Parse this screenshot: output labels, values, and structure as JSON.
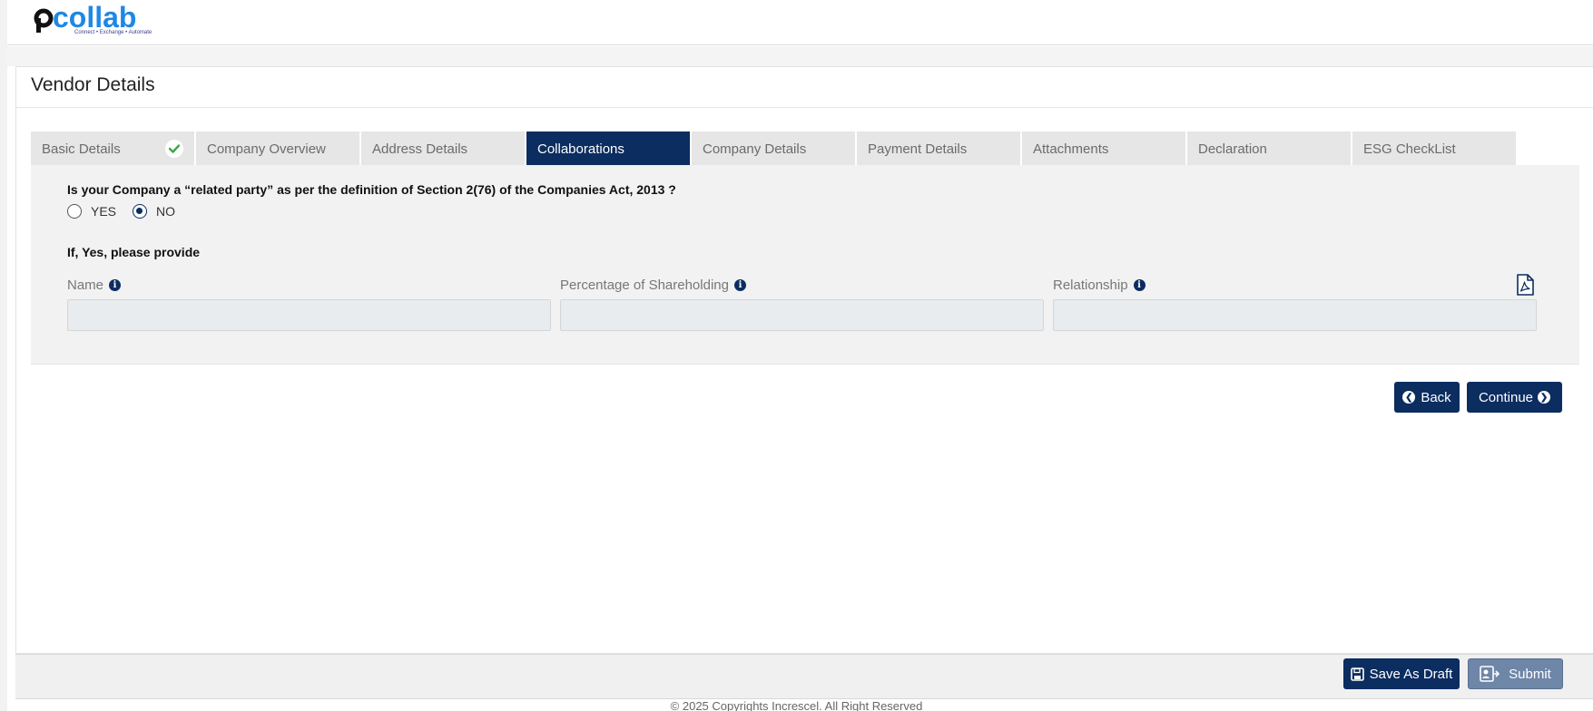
{
  "header": {
    "logo_text": "pcollab",
    "logo_tagline": "Connect • Exchange • Automate"
  },
  "card": {
    "title": "Vendor Details"
  },
  "tabs": [
    {
      "label": "Basic Details",
      "completed": true
    },
    {
      "label": "Company Overview"
    },
    {
      "label": "Address Details"
    },
    {
      "label": "Collaborations",
      "active": true
    },
    {
      "label": "Company Details"
    },
    {
      "label": "Payment Details"
    },
    {
      "label": "Attachments"
    },
    {
      "label": "Declaration"
    },
    {
      "label": "ESG CheckList"
    }
  ],
  "form": {
    "question": "Is your Company a “related party” as per the definition of Section 2(76) of the Companies Act, 2013 ?",
    "options": [
      {
        "label": "YES",
        "checked": false
      },
      {
        "label": "NO",
        "checked": true
      }
    ],
    "sub_label": "If, Yes, please provide",
    "fields": [
      {
        "label": "Name",
        "value": ""
      },
      {
        "label": "Percentage of Shareholding",
        "value": ""
      },
      {
        "label": "Relationship",
        "value": ""
      }
    ]
  },
  "nav": {
    "back_label": "Back",
    "continue_label": "Continue"
  },
  "footer": {
    "save_draft_label": "Save As Draft",
    "submit_label": "Submit",
    "copyright": "© 2025 Copyrights Increscel. All Right Reserved"
  },
  "colors": {
    "primary": "#0b2d60",
    "tab_inactive": "#e6e6e6",
    "panel_bg": "#f2f2f2",
    "submit_disabled": "#6e86a8",
    "check_green": "#3aa84a"
  },
  "icons": [
    "check-icon",
    "info-icon",
    "pdf-icon",
    "arrow-left-circle-icon",
    "arrow-right-circle-icon",
    "save-icon",
    "submit-icon"
  ]
}
